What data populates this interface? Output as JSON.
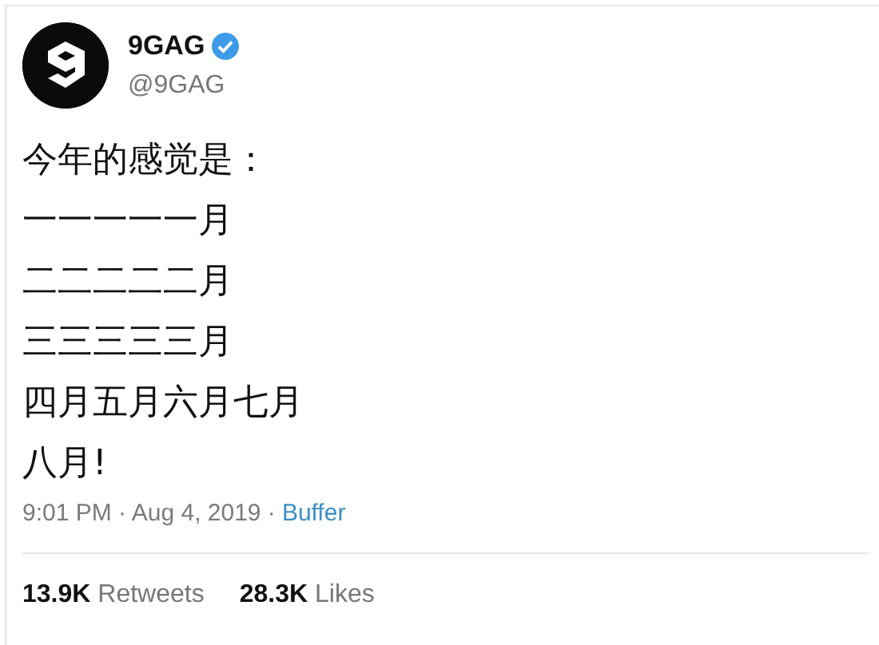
{
  "author": {
    "name": "9GAG",
    "verified": true,
    "handle": "@9GAG"
  },
  "lines": [
    "今年的感觉是：",
    "一一一一一月",
    "二二二二二月",
    "三三三三三月",
    "四月五月六月七月",
    "八月!"
  ],
  "meta": {
    "timestamp": "9:01 PM · Aug 4, 2019 ·",
    "source": "Buffer"
  },
  "stats": [
    "**13.9K** Retweets",
    "**28.3K** Likes"
  ]
}
